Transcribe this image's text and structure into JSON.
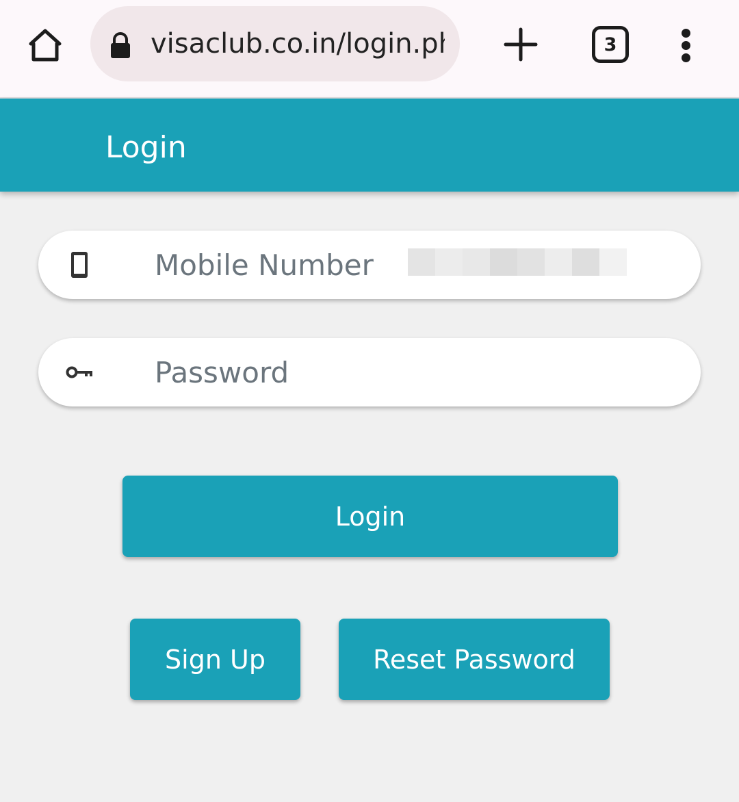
{
  "browser": {
    "url": "visaclub.co.in/login.php",
    "tab_count": "3",
    "icons": {
      "home": "home-icon",
      "lock": "lock-icon",
      "new_tab": "plus-icon",
      "tabs": "tab-switcher-icon",
      "menu": "more-vert-icon"
    }
  },
  "header": {
    "title": "Login"
  },
  "form": {
    "mobile": {
      "placeholder": "Mobile Number",
      "value": "",
      "icon": "mobile-phone-icon"
    },
    "password": {
      "placeholder": "Password",
      "value": "",
      "icon": "key-icon"
    }
  },
  "actions": {
    "login_label": "Login",
    "signup_label": "Sign Up",
    "reset_label": "Reset Password"
  },
  "colors": {
    "accent": "#1aa1b7",
    "background": "#f0f0f0",
    "browser_bar": "#fdf8fb",
    "url_pill": "#f1e7ea"
  }
}
